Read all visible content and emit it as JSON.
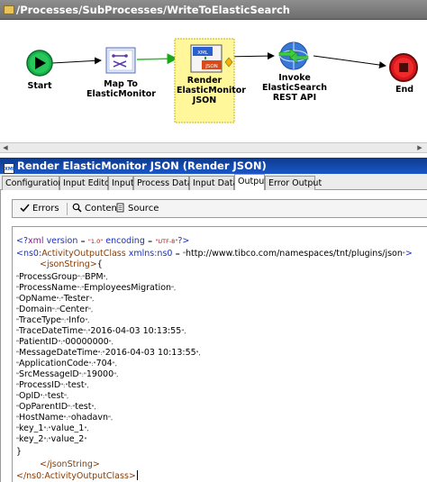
{
  "window": {
    "path": "/Processes/SubProcesses/WriteToElasticSearch"
  },
  "process": {
    "nodes": [
      {
        "label": "Start"
      },
      {
        "label": "Map To ElasticMonitor"
      },
      {
        "label": "Render ElasticMonitor JSON",
        "icon_text": "XML",
        "icon_text2": "JSON"
      },
      {
        "label": "Invoke ElasticSearch REST API"
      },
      {
        "label": "End"
      }
    ],
    "colors": {
      "selection": "#fff79a",
      "transition": "#22c522",
      "start": "#16b24a",
      "end": "#d8161e"
    }
  },
  "panel": {
    "title": "Render ElasticMonitor JSON (Render JSON)",
    "title_icon": "XML",
    "tabs": [
      "Configuration",
      "Input Editor",
      "Input",
      "Process Data",
      "Input Data",
      "Output",
      "Error Output"
    ],
    "active_tab": "Output"
  },
  "toolbar": {
    "errors": "Errors",
    "content": "Content",
    "source": "Source"
  },
  "xml": {
    "decl_open": "<?",
    "decl_name": "xml",
    "version_attr": "version",
    "version_val": "\"1.0\"",
    "encoding_attr": "encoding",
    "encoding_val": "\"UTF-8\"",
    "decl_close": "?>",
    "root_open": "<ns0:",
    "root_name": "ActivityOutputClass",
    "xmlns_attr": "xmlns:ns0",
    "xmlns_val": "http://www.tibco.com/namespaces/tnt/plugins/json",
    "root_close_bracket": ">",
    "json_tag_open": "<jsonString>",
    "json_tag_close": "</jsonString>",
    "root_end": "</ns0:ActivityOutputClass>",
    "brace_open": "{",
    "brace_close": "}",
    "fields": [
      {
        "key": "ProcessGroup",
        "value": "BPM"
      },
      {
        "key": "ProcessName",
        "value": "EmployeesMigration"
      },
      {
        "key": "OpName",
        "value": "Tester"
      },
      {
        "key": "Domain",
        "value": "Center"
      },
      {
        "key": "TraceType",
        "value": "Info"
      },
      {
        "key": "TraceDateTime",
        "value": "2016-04-03 10:13:55"
      },
      {
        "key": "PatientID",
        "value": "00000000"
      },
      {
        "key": "MessageDateTime",
        "value": "2016-04-03 10:13:55"
      },
      {
        "key": "ApplicationCode",
        "value": "704"
      },
      {
        "key": "SrcMessageID",
        "value": "19000"
      },
      {
        "key": "ProcessID",
        "value": "test"
      },
      {
        "key": "OpID",
        "value": "test"
      },
      {
        "key": "OpParentID",
        "value": "test"
      },
      {
        "key": "HostName",
        "value": "ohadavn"
      },
      {
        "key": "key_1",
        "value": "value_1"
      },
      {
        "key": "key_2",
        "value": "value_2"
      }
    ]
  }
}
